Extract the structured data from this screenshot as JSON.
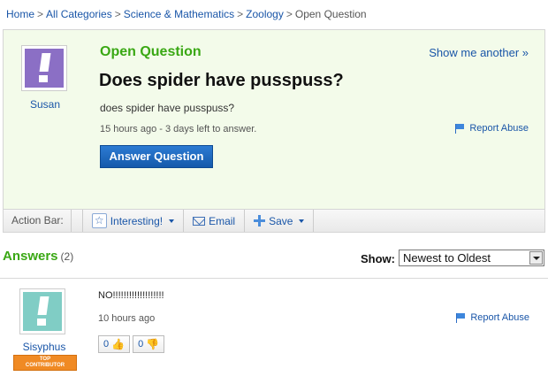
{
  "breadcrumb": [
    {
      "label": "Home"
    },
    {
      "label": "All Categories"
    },
    {
      "label": "Science & Mathematics"
    },
    {
      "label": "Zoology"
    }
  ],
  "breadcrumb_current": "Open Question",
  "breadcrumb_sep": ">",
  "question": {
    "status_label": "Open Question",
    "show_another": "Show me another »",
    "title": "Does spider have pusspuss?",
    "body": "does spider have pusspuss?",
    "meta": "15 hours ago - 3 days left to answer.",
    "report": "Report Abuse",
    "answer_button": "Answer Question",
    "asker": "Susan",
    "asker_avatar_color": "#8b6fc5"
  },
  "action_bar": {
    "label": "Action Bar:",
    "interesting": "Interesting!",
    "email": "Email",
    "save": "Save"
  },
  "answers": {
    "heading": "Answers",
    "count": "(2)",
    "show_label": "Show:",
    "sort_selected": "Newest to Oldest",
    "items": [
      {
        "author": "Sisyphus",
        "badge_line1": "TOP",
        "badge_line2": "CONTRIBUTOR",
        "avatar_color": "#80cdc5",
        "body": "NO!!!!!!!!!!!!!!!!!!!",
        "meta": "10 hours ago",
        "report": "Report Abuse",
        "thumbs_up": "0",
        "thumbs_down": "0"
      }
    ]
  },
  "colors": {
    "accent_green": "#3aa814",
    "link_blue": "#1a56a8",
    "question_bg": "#f3fbea",
    "badge_orange": "#f08a24"
  }
}
